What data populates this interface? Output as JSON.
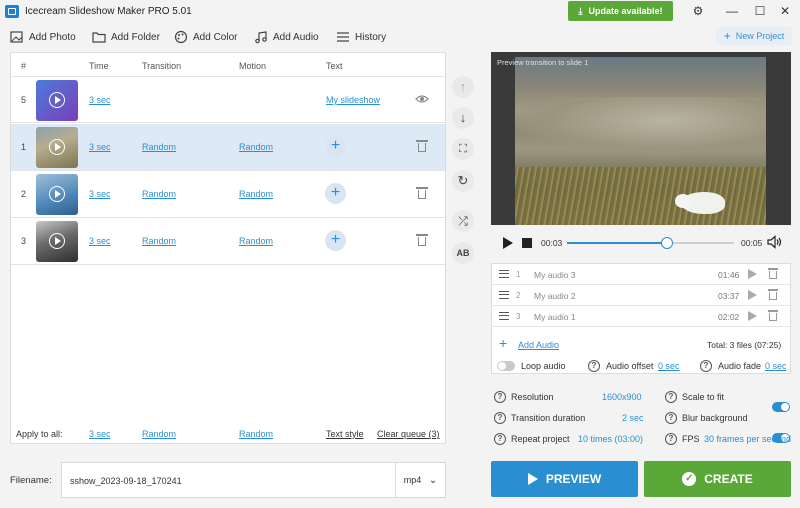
{
  "window": {
    "title": "Icecream Slideshow Maker PRO 5.01",
    "update_label": "Update available!",
    "minimize": "—",
    "maximize": "☐",
    "close": "✕"
  },
  "toolbar": {
    "add_photo": "Add Photo",
    "add_folder": "Add Folder",
    "add_color": "Add Color",
    "add_audio": "Add Audio",
    "history": "History",
    "new_project": "New Project"
  },
  "table": {
    "headers": {
      "num": "#",
      "time": "Time",
      "transition": "Transition",
      "motion": "Motion",
      "text": "Text"
    },
    "rows": [
      {
        "num": "5",
        "time": "3 sec",
        "transition": "",
        "motion": "",
        "text": "My slideshow",
        "selected": false,
        "thumb": [
          "#4b7bd9",
          "#7b3fb8"
        ]
      },
      {
        "num": "1",
        "time": "3 sec",
        "transition": "Random",
        "motion": "Random",
        "text": "",
        "selected": true,
        "thumb": [
          "#b7ad8f",
          "#7d7553"
        ]
      },
      {
        "num": "2",
        "time": "3 sec",
        "transition": "Random",
        "motion": "Random",
        "text": "",
        "selected": false,
        "thumb": [
          "#4d86b8",
          "#9fbfd9"
        ]
      },
      {
        "num": "3",
        "time": "3 sec",
        "transition": "Random",
        "motion": "Random",
        "text": "",
        "selected": false,
        "thumb": [
          "#3b3b3b",
          "#c8c8c8"
        ]
      }
    ],
    "apply_all": {
      "label": "Apply to all:",
      "time": "3 sec",
      "transition": "Random",
      "motion": "Random",
      "text_style": "Text style",
      "clear_queue": "Clear queue (3)"
    }
  },
  "filename": {
    "label": "Filename:",
    "value": "sshow_2023-09-18_170241",
    "format": "mp4"
  },
  "preview": {
    "caption": "Preview transition to slide 1",
    "current_time": "00:03",
    "duration": "00:05",
    "progress": 0.6
  },
  "audio": {
    "items": [
      {
        "num": "1",
        "name": "My audio 3",
        "duration": "01:46"
      },
      {
        "num": "2",
        "name": "My audio 2",
        "duration": "03:37"
      },
      {
        "num": "3",
        "name": "My audio 1",
        "duration": "02:02"
      }
    ],
    "add_label": "Add Audio",
    "total": "Total: 3 files (07:25)",
    "loop_label": "Loop audio",
    "offset_label": "Audio offset",
    "offset_value": "0 sec",
    "fade_label": "Audio fade",
    "fade_value": "0 sec"
  },
  "settings": {
    "resolution_label": "Resolution",
    "resolution_value": "1600x900",
    "transition_label": "Transition duration",
    "transition_value": "2 sec",
    "repeat_label": "Repeat project",
    "repeat_value": "10 times (03:00)",
    "scale_label": "Scale to fit",
    "blur_label": "Blur background",
    "fps_label": "FPS",
    "fps_value": "30 frames per second",
    "scale_on": true,
    "blur_on": true
  },
  "actions": {
    "preview": "PREVIEW",
    "create": "CREATE"
  },
  "colors": {
    "accent": "#2a8fd0",
    "green": "#5aa837",
    "selected_row": "#ddeaf6"
  }
}
